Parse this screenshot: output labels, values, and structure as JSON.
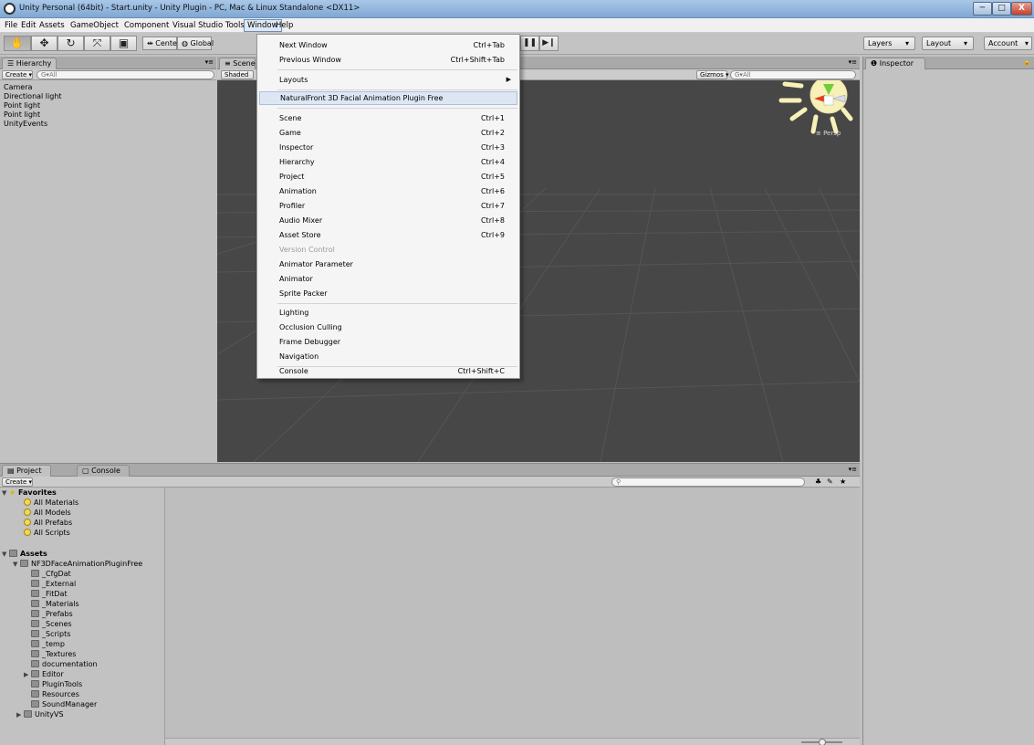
{
  "window": {
    "title": "Unity Personal (64bit) - Start.unity - Unity Plugin - PC, Mac & Linux Standalone <DX11>",
    "min": "─",
    "max": "□",
    "close": "X"
  },
  "menubar": [
    "File",
    "Edit",
    "Assets",
    "GameObject",
    "Component",
    "Visual Studio Tools",
    "Window",
    "Help"
  ],
  "toolbar": {
    "pivot": "Center",
    "space": "Global",
    "layers": "Layers",
    "layout": "Layout",
    "account": "Account"
  },
  "hierarchy": {
    "tab": "Hierarchy",
    "create": "Create",
    "search": "G▾All",
    "items": [
      "Camera",
      "Directional light",
      "Point light",
      "Point light",
      "UnityEvents"
    ]
  },
  "scene": {
    "tab": "Scene",
    "shading": "Shaded",
    "gizmos": "Gizmos",
    "search": "G▾All",
    "persp": "≡ Persp"
  },
  "inspector": {
    "tab": "Inspector"
  },
  "project": {
    "tabs": [
      "Project",
      "Console"
    ],
    "create": "Create",
    "favorites": "Favorites",
    "favorites_items": [
      "All Materials",
      "All Models",
      "All Prefabs",
      "All Scripts"
    ],
    "assets": "Assets",
    "plugin_folder": "NF3DFaceAnimationPluginFree",
    "plugin_children": [
      "_CfgDat",
      "_External",
      "_FitDat",
      "_Materials",
      "_Prefabs",
      "_Scenes",
      "_Scripts",
      "_temp",
      "_Textures",
      "documentation",
      "Editor",
      "PluginTools",
      "Resources",
      "SoundManager"
    ],
    "unityvs": "UnityVS"
  },
  "window_menu": {
    "items": [
      {
        "label": "Next Window",
        "shortcut": "Ctrl+Tab"
      },
      {
        "label": "Previous Window",
        "shortcut": "Ctrl+Shift+Tab"
      },
      {
        "label": "Layouts",
        "shortcut": ""
      },
      {
        "label": "NaturalFront 3D Facial Animation Plugin Free",
        "shortcut": ""
      },
      {
        "label": "Scene",
        "shortcut": "Ctrl+1"
      },
      {
        "label": "Game",
        "shortcut": "Ctrl+2"
      },
      {
        "label": "Inspector",
        "shortcut": "Ctrl+3"
      },
      {
        "label": "Hierarchy",
        "shortcut": "Ctrl+4"
      },
      {
        "label": "Project",
        "shortcut": "Ctrl+5"
      },
      {
        "label": "Animation",
        "shortcut": "Ctrl+6"
      },
      {
        "label": "Profiler",
        "shortcut": "Ctrl+7"
      },
      {
        "label": "Audio Mixer",
        "shortcut": "Ctrl+8"
      },
      {
        "label": "Asset Store",
        "shortcut": "Ctrl+9"
      },
      {
        "label": "Version Control",
        "shortcut": ""
      },
      {
        "label": "Animator Parameter",
        "shortcut": ""
      },
      {
        "label": "Animator",
        "shortcut": ""
      },
      {
        "label": "Sprite Packer",
        "shortcut": ""
      },
      {
        "label": "Lighting",
        "shortcut": ""
      },
      {
        "label": "Occlusion Culling",
        "shortcut": ""
      },
      {
        "label": "Frame Debugger",
        "shortcut": ""
      },
      {
        "label": "Navigation",
        "shortcut": ""
      },
      {
        "label": "Console",
        "shortcut": "Ctrl+Shift+C"
      }
    ]
  },
  "colors": {
    "scene_bg": "#474747",
    "panel_bg": "#c2c2c2",
    "menu_highlight": "#dde7f4"
  }
}
